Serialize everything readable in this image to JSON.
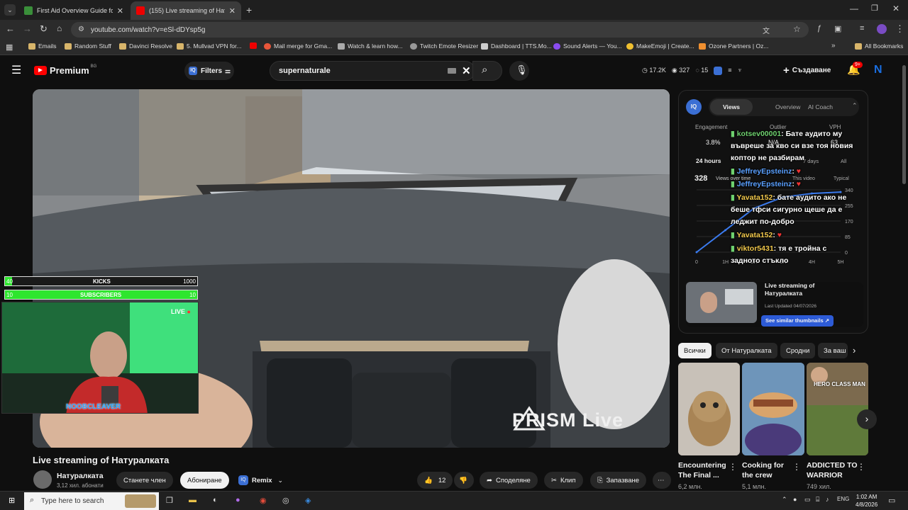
{
  "browser": {
    "tabs": [
      {
        "title": "First Aid Overview Guide for TB",
        "active": false
      },
      {
        "title": "(155) Live streaming of Натуралката",
        "active": true
      }
    ],
    "url": "youtube.com/watch?v=eSl-dDYsp5g",
    "bookmarks": [
      "Emails",
      "Random Stuff",
      "Davinci Resolve",
      "5. Mullvad VPN for...",
      "Mail merge for Gma...",
      "Watch & learn how...",
      "Twitch Emote Resizer",
      "Dashboard | TTS.Mo...",
      "Sound Alerts — You...",
      "MakeEmoji | Create...",
      "Ozone Partners | Oz...",
      "All Bookmarks"
    ]
  },
  "header": {
    "logo": "Premium",
    "logo_country": "BG",
    "filters_label": "Filters",
    "search_value": "supernaturale",
    "stats": {
      "views": "17.2K",
      "watching": "327",
      "count": "15"
    },
    "create_label": "Създаване",
    "notif_badge": "9+"
  },
  "overlay": {
    "kicks_left": "40",
    "kicks_label": "KICKS",
    "kicks_right": "1000",
    "subs_left": "10",
    "subs_label": "SUBSCRIBERS",
    "subs_right": "10",
    "live_label": "LIVE",
    "cam_name": "NOOBCLEAVER",
    "watermark": "PRISM Live"
  },
  "video": {
    "title": "Live streaming of Натуралката",
    "channel": "Натуралката",
    "subscribers": "3,12 хил. абонати",
    "join_label": "Станете член",
    "subscribe_label": "Абониране",
    "remix_label": "Remix",
    "likes": "12",
    "share_label": "Споделяне",
    "clip_label": "Клип",
    "save_label": "Запазване"
  },
  "vidiq": {
    "tabs": [
      "Views",
      "Overview",
      "AI Coach"
    ],
    "engagement_label": "Engagement",
    "engagement_value": "3.8%",
    "outlier_label": "Outlier",
    "outlier_value": "N/A",
    "vph_label": "VPH",
    "vph_value": "63",
    "range_label": "24 hours",
    "days_label": "7 days",
    "all_label": "All",
    "views_value": "328",
    "views_over_time": "Views over time",
    "this_video": "This video",
    "typical": "Typical",
    "y_ticks": [
      "340",
      "255",
      "170",
      "85",
      "0"
    ],
    "x_ticks": [
      "0",
      "1H",
      "2H",
      "3H",
      "4H",
      "5H"
    ],
    "card_title": "Live streaming of Натуралката",
    "card_updated": "Last Updated 04/07/2026",
    "card_button": "See similar thumbnails"
  },
  "chart_data": {
    "type": "line",
    "x": [
      "0",
      "1H",
      "2H",
      "3H",
      "4H",
      "5H"
    ],
    "series": [
      {
        "values": [
          0,
          120,
          240,
          300,
          320,
          328
        ]
      }
    ],
    "ylim": [
      0,
      340
    ]
  },
  "chat": [
    {
      "user": "kotsev00001",
      "text": ": Бате аудито му въвреше за кво си взе тоя новия коптор не разбирам",
      "color": "green"
    },
    {
      "user": "JeffreyEpsteinz",
      "text": ":",
      "color": "blue"
    },
    {
      "user": "JeffreyEpsteinz",
      "text": ":",
      "color": "blue"
    },
    {
      "user": "Yavata152",
      "text": ": бате аудито ако не беше тфси сигурно щеше да е леджит по-добро",
      "color": "yellow"
    },
    {
      "user": "Yavata152",
      "text": ":",
      "color": "yellow"
    },
    {
      "user": "viktor5431",
      "text": ": тя е тройна с задното стъкло",
      "color": "yellow"
    }
  ],
  "chips": [
    "Всички",
    "От Натуралката",
    "Сродни",
    "За ваш"
  ],
  "recommended": [
    {
      "title": "Encountering The Final ...",
      "sub": "6,2 млн."
    },
    {
      "title": "Cooking for the crew",
      "sub": "5,1 млн."
    },
    {
      "title": "ADDICTED TO WARRIOR",
      "sub": "749 хил."
    }
  ],
  "thumb_text": "HERO CLASS MAN",
  "taskbar": {
    "search_placeholder": "Type here to search",
    "lang": "ENG",
    "time": "1:02 AM",
    "date": "4/8/2026"
  }
}
